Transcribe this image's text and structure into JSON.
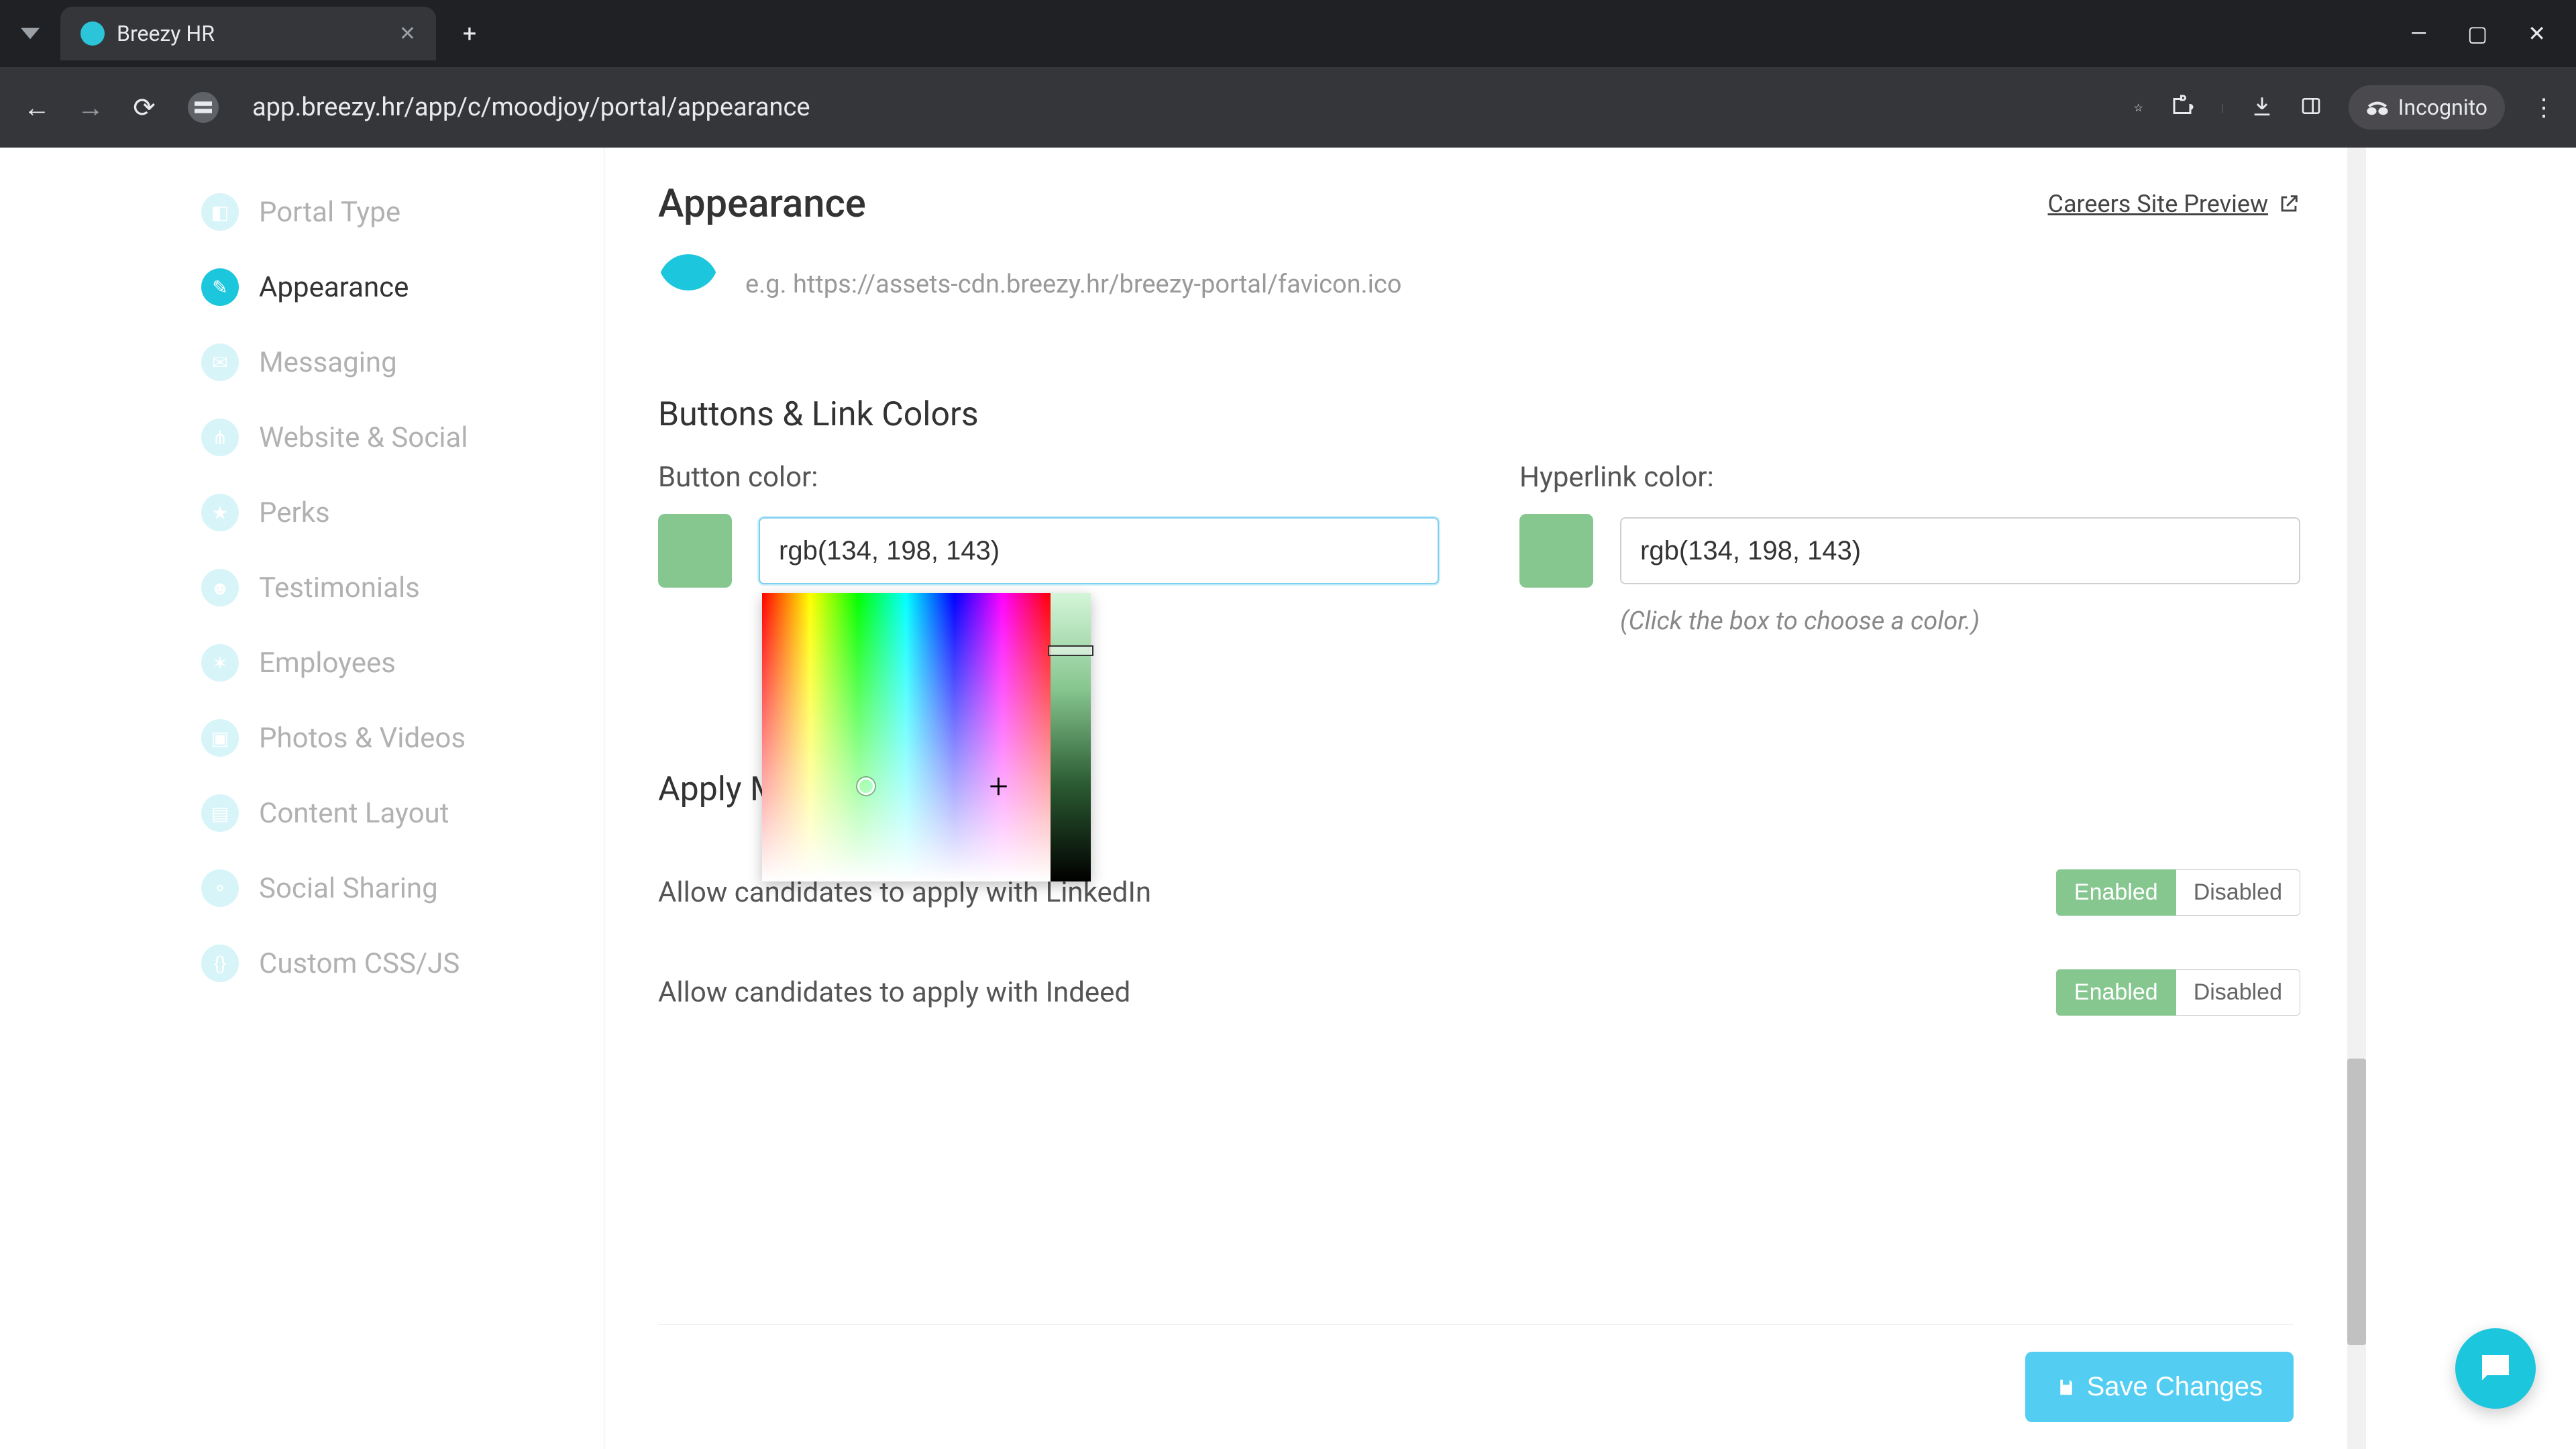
{
  "browser": {
    "tab_title": "Breezy HR",
    "url": "app.breezy.hr/app/c/moodjoy/portal/appearance",
    "incognito_label": "Incognito"
  },
  "sidebar": {
    "items": [
      {
        "label": "Portal Type"
      },
      {
        "label": "Appearance"
      },
      {
        "label": "Messaging"
      },
      {
        "label": "Website & Social"
      },
      {
        "label": "Perks"
      },
      {
        "label": "Testimonials"
      },
      {
        "label": "Employees"
      },
      {
        "label": "Photos & Videos"
      },
      {
        "label": "Content Layout"
      },
      {
        "label": "Social Sharing"
      },
      {
        "label": "Custom CSS/JS"
      }
    ],
    "active_index": 1
  },
  "header": {
    "title": "Appearance",
    "preview_label": "Careers Site Preview"
  },
  "favicon_hint": "e.g. https://assets-cdn.breezy.hr/breezy-portal/favicon.ico",
  "section_colors_title": "Buttons & Link Colors",
  "button_color": {
    "label": "Button color:",
    "value": "rgb(134, 198, 143)",
    "swatch_hex": "#86c68f",
    "hint_suffix": "color.)"
  },
  "hyperlink_color": {
    "label": "Hyperlink color:",
    "value": "rgb(134, 198, 143)",
    "swatch_hex": "#86c68f",
    "hint": "(Click the box to choose a color.)"
  },
  "apply_section": {
    "visible_title_fragment": "Apply M",
    "linkedin": {
      "label": "Allow candidates to apply with LinkedIn",
      "enabled_label": "Enabled",
      "disabled_label": "Disabled",
      "state": "enabled"
    },
    "indeed": {
      "label": "Allow candidates to apply with Indeed",
      "enabled_label": "Enabled",
      "disabled_label": "Disabled",
      "state": "enabled"
    }
  },
  "save_label": "Save Changes",
  "colors": {
    "accent": "#1cc7dd",
    "green": "#86c68f",
    "save": "#53cef2"
  }
}
